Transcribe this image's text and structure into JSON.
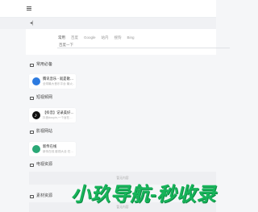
{
  "search": {
    "engines": [
      "常用",
      "百度",
      "Google",
      "站内",
      "搜狗",
      "Bing"
    ],
    "placeholder": "百度一下"
  },
  "sections": [
    {
      "title": "常用必备"
    },
    {
      "title": "短视频网"
    },
    {
      "title": "影视网站"
    },
    {
      "title": "电视资源"
    },
    {
      "title": "素材资源"
    }
  ],
  "cards": [
    {
      "name": "腾讯音乐 - 就是歌…",
      "desc": "全球最大音乐平台 最火…",
      "icon": "weread-icon"
    },
    {
      "name": "【抖音】记录美好…",
      "desc": "抖音douyin,一个旨在…",
      "icon": "douyin-icon"
    },
    {
      "name": "新传在线",
      "desc": "新传在线 影视大全 在…",
      "icon": "xinchuan-icon"
    }
  ],
  "placeholders": [
    "暂无内容",
    "暂无内容"
  ],
  "watermark": "小玖导航-秒收录",
  "colors": {
    "accent": "#17b45a",
    "active_engine": "#555555"
  }
}
